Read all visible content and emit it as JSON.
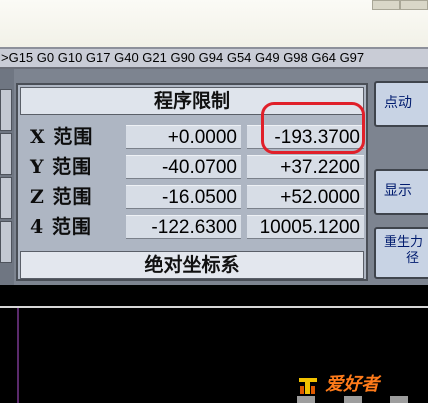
{
  "gcode_modes": ">G15  G0 G10 G17 G40 G21 G90 G94 G54 G49 G98 G64 G97",
  "panel": {
    "title": "程序限制",
    "footer": "绝对坐标系",
    "rows": [
      {
        "label": "X 范围",
        "min": "+0.0000",
        "max": "-193.3700"
      },
      {
        "label": "Y 范围",
        "min": "-40.0700",
        "max": "+37.2200"
      },
      {
        "label": "Z 范围",
        "min": "-16.0500",
        "max": "+52.0000"
      },
      {
        "label": "4 范围",
        "min": "-122.6300",
        "max": "10005.1200"
      }
    ]
  },
  "side_buttons": {
    "jog": "点动",
    "display": "显示",
    "regen_line1": "重生力",
    "regen_line2": "径"
  },
  "watermark": {
    "text": "爱好者",
    "icon": "wood-logo-icon"
  },
  "colors": {
    "highlight": "#e0202a",
    "panel_bg": "#aeb6c3",
    "button_text": "#001b6e",
    "watermark": "#ff7b1a"
  }
}
